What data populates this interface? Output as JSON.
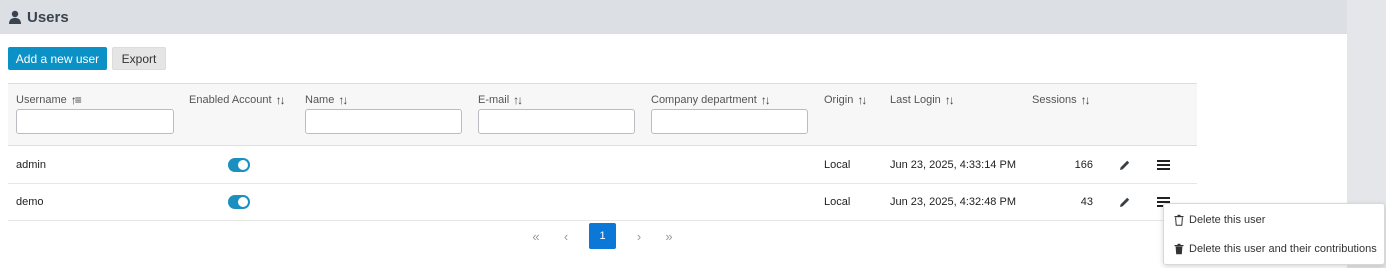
{
  "page": {
    "title": "Users"
  },
  "toolbar": {
    "add_label": "Add a new user",
    "export_label": "Export"
  },
  "columns": {
    "username": "Username",
    "enabled": "Enabled Account",
    "name": "Name",
    "email": "E-mail",
    "department": "Company department",
    "origin": "Origin",
    "last_login": "Last Login",
    "sessions": "Sessions"
  },
  "filters": {
    "username": "",
    "name": "",
    "email": "",
    "department": ""
  },
  "rows": [
    {
      "username": "admin",
      "enabled": true,
      "origin": "Local",
      "last_login": "Jun 23, 2025, 4:33:14 PM",
      "sessions": "166"
    },
    {
      "username": "demo",
      "enabled": true,
      "origin": "Local",
      "last_login": "Jun 23, 2025, 4:32:48 PM",
      "sessions": "43"
    }
  ],
  "pagination": {
    "first": "«",
    "prev": "‹",
    "current": "1",
    "next": "›",
    "last": "»"
  },
  "row_menu": {
    "delete_user": "Delete this user",
    "delete_user_contrib": "Delete this user and their contributions"
  },
  "colors": {
    "accent": "#0c91c7",
    "header_bg": "#dcdfe3",
    "active_page": "#0b78d7",
    "toggle_on": "#1a8fc0"
  },
  "icons": {
    "header": "user-icon",
    "sort": "sort-icon",
    "edit": "pencil-icon",
    "menu": "hamburger-icon",
    "delete": "trash-icon"
  }
}
